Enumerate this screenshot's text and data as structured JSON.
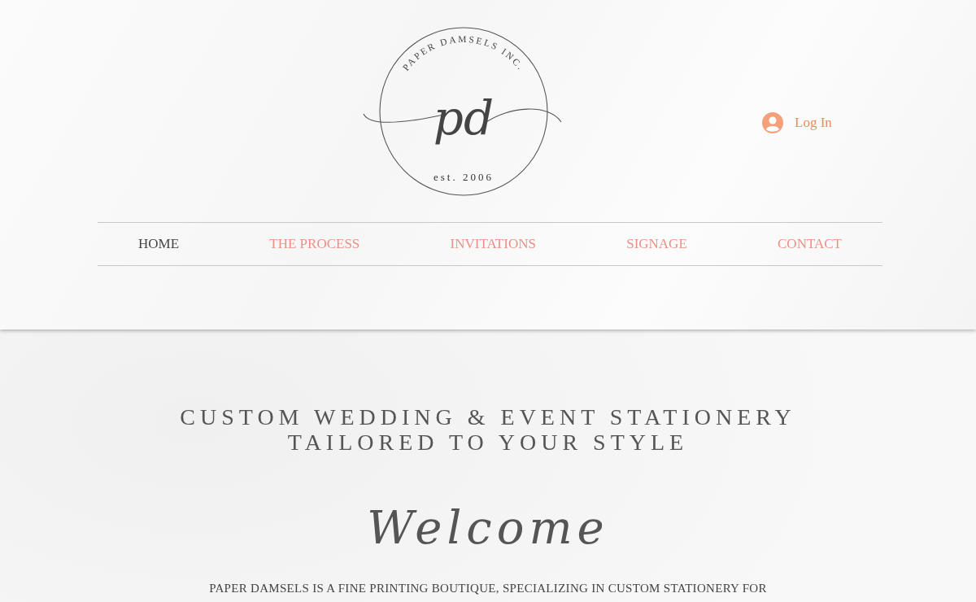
{
  "logo": {
    "arc_text": "PAPER DAMSELS INC.",
    "monogram": "pd",
    "established": "est. 2006"
  },
  "login": {
    "label": "Log In"
  },
  "nav": [
    {
      "label": "HOME",
      "selected": true
    },
    {
      "label": "THE PROCESS",
      "selected": false
    },
    {
      "label": "INVITATIONS",
      "selected": false
    },
    {
      "label": "SIGNAGE",
      "selected": false
    },
    {
      "label": "CONTACT",
      "selected": false
    }
  ],
  "hero": {
    "headline": [
      "CUSTOM WEDDING & EVENT STATIONERY",
      "TAILORED TO YOUR STYLE"
    ],
    "welcome": "Welcome",
    "intro": "PAPER DAMSELS IS A FINE PRINTING BOUTIQUE, SPECIALIZING IN CUSTOM STATIONERY FOR"
  }
}
